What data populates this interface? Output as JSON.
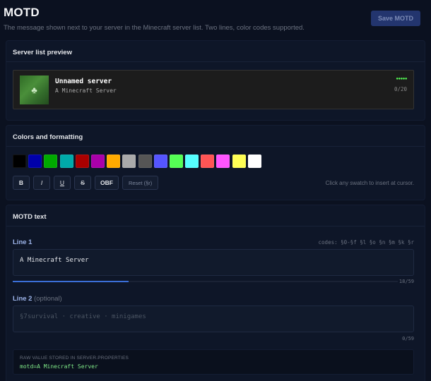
{
  "header": {
    "title": "MOTD",
    "subtitle": "The message shown next to your server in the Minecraft server list. Two lines, color codes supported.",
    "save_label": "Save MOTD"
  },
  "preview_section": {
    "title": "Server list preview",
    "server_name": "Unnamed server",
    "motd_line": "A Minecraft Server",
    "ping_bars": "●●●●●",
    "players": "0/20",
    "icon": "minecraft-tree-icon"
  },
  "colors_section": {
    "title": "Colors and formatting",
    "swatches": [
      "#000000",
      "#0000aa",
      "#00aa00",
      "#00aaaa",
      "#aa0000",
      "#aa00aa",
      "#ffaa00",
      "#aaaaaa",
      "#555555",
      "#5555ff",
      "#55ff55",
      "#55ffff",
      "#ff5555",
      "#ff55ff",
      "#ffff55",
      "#ffffff"
    ],
    "format_buttons": {
      "bold": "B",
      "italic": "I",
      "underline": "U",
      "strike": "S",
      "obfuscated": "OBF",
      "reset": "Reset (§r)"
    },
    "hint": "Click any swatch to insert at cursor."
  },
  "motd_section": {
    "title": "MOTD text",
    "line1": {
      "label": "Line 1",
      "codes": "codes: §0-§f §l §o §n §m §k §r",
      "value": "A Minecraft Server",
      "count": "18/59",
      "progress_fraction": 0.3
    },
    "line2": {
      "label": "Line 2",
      "optional": "(optional)",
      "placeholder": "§7survival · creative · minigames",
      "count": "0/59",
      "progress_fraction": 0
    },
    "raw": {
      "label": "Raw value stored in server.properties",
      "value": "motd=A Minecraft Server"
    }
  },
  "colors": {
    "background": "#0b1120",
    "card": "#0e1628",
    "accent": "#3b6fd8",
    "save_button": "#23356e",
    "raw_value": "#7ee787"
  }
}
